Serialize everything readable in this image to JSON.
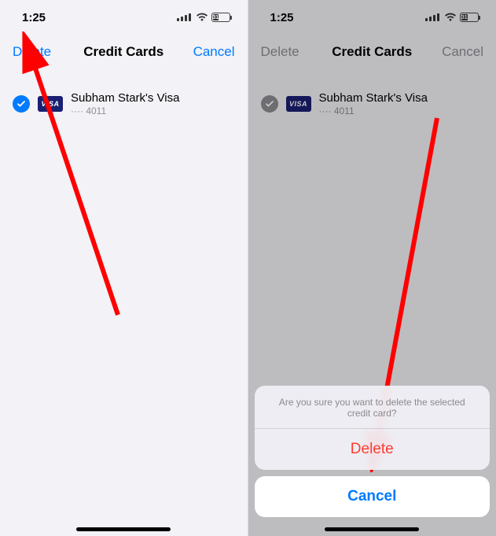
{
  "status": {
    "time": "1:25",
    "battery_pct": "31"
  },
  "nav": {
    "delete": "Delete",
    "title": "Credit Cards",
    "cancel": "Cancel"
  },
  "card": {
    "brand": "VISA",
    "name": "Subham Stark's Visa",
    "masked_number": "···· 4011"
  },
  "sheet": {
    "message": "Are you sure you want to delete the selected credit card?",
    "delete_label": "Delete",
    "cancel_label": "Cancel"
  },
  "battery_fill_width": "38%"
}
